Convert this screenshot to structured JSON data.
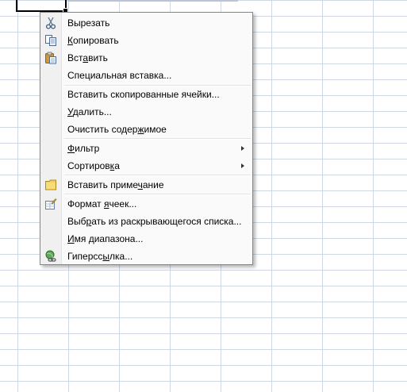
{
  "menu": {
    "items": [
      {
        "pre": "",
        "key": "",
        "post": "Вырезать",
        "icon": "scissors-icon"
      },
      {
        "pre": "",
        "key": "К",
        "post": "опировать",
        "icon": "copy-icon"
      },
      {
        "pre": "Вст",
        "key": "а",
        "post": "вить",
        "icon": "paste-icon"
      },
      {
        "pre": "Специальная вставка...",
        "key": "",
        "post": "",
        "icon": ""
      },
      {
        "pre": "Вставить скопированные ячейки...",
        "key": "",
        "post": "",
        "icon": ""
      },
      {
        "pre": "",
        "key": "У",
        "post": "далить...",
        "icon": ""
      },
      {
        "pre": "Очистить содер",
        "key": "ж",
        "post": "имое",
        "icon": ""
      },
      {
        "pre": "",
        "key": "Ф",
        "post": "ильтр",
        "icon": "",
        "submenu": true
      },
      {
        "pre": "Сортиров",
        "key": "к",
        "post": "а",
        "icon": "",
        "submenu": true
      },
      {
        "pre": "Вставить приме",
        "key": "ч",
        "post": "ание",
        "icon": "comment-icon"
      },
      {
        "pre": "Формат ",
        "key": "я",
        "post": "чеек...",
        "icon": "format-cells-icon"
      },
      {
        "pre": "Выб",
        "key": "р",
        "post": "ать из раскрывающегося списка...",
        "icon": ""
      },
      {
        "pre": "",
        "key": "И",
        "post": "мя диапазона...",
        "icon": ""
      },
      {
        "pre": "Гиперсс",
        "key": "ы",
        "post": "лка...",
        "icon": "hyperlink-icon"
      }
    ]
  },
  "colors": {
    "grid": "#d0d7e5",
    "menu_border": "#868686",
    "gutter": "#f0f0f0"
  }
}
